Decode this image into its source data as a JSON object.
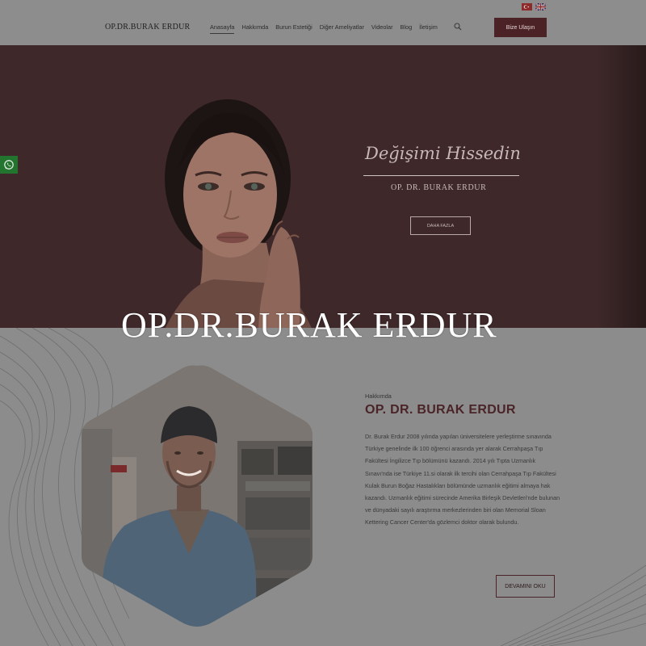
{
  "header": {
    "logo": "OP.DR.BURAK ERDUR",
    "nav": [
      {
        "label": "Anasayfa",
        "active": true
      },
      {
        "label": "Hakkımda",
        "active": false
      },
      {
        "label": "Burun Estetiği",
        "active": false
      },
      {
        "label": "Diğer Ameliyatlar",
        "active": false
      },
      {
        "label": "Videolar",
        "active": false
      },
      {
        "label": "Blog",
        "active": false
      },
      {
        "label": "İletişim",
        "active": false
      }
    ],
    "cta_label": "Bize Ulaşın",
    "languages": [
      {
        "name": "tr-flag-icon"
      },
      {
        "name": "en-flag-icon"
      }
    ]
  },
  "hero": {
    "script_title": "Değişimi Hissedin",
    "subtitle": "OP. DR. BURAK ERDUR",
    "button_label": "DAHA FAZLA",
    "big_title": "OP.DR.BURAK ERDUR"
  },
  "about": {
    "kicker": "Hakkımda",
    "title": "OP. DR. BURAK ERDUR",
    "paragraph": "Dr. Burak Erdur 2008 yılında yapılan üniversitelere yerleştirme sınavında Türkiye genelinde ilk 100 öğrenci arasında yer alarak Cerrahpaşa Tıp Fakültesi İngilizce Tıp bölümünü kazandı. 2014 yılı Tıpta Uzmanlık Sınavı'nda ise Türkiye 11.si olarak ilk tercihi olan Cerrahpaşa Tıp Fakültesi Kulak Burun Boğaz Hastalıkları bölümünde uzmanlık eğitimi almaya hak kazandı. Uzmanlık eğitimi sürecinde Amerika Birleşik Devletleri'nde bulunan ve dünyadaki sayılı araştırma merkezlerinden biri olan Memorial Sloan Kettering Cancer Center'da gözlemci doktor olarak bulundu.",
    "button_label": "DEVAMINI OKU"
  },
  "colors": {
    "brand": "#4b2326",
    "hero_bg": "#3e2829",
    "whatsapp": "#23742f"
  }
}
